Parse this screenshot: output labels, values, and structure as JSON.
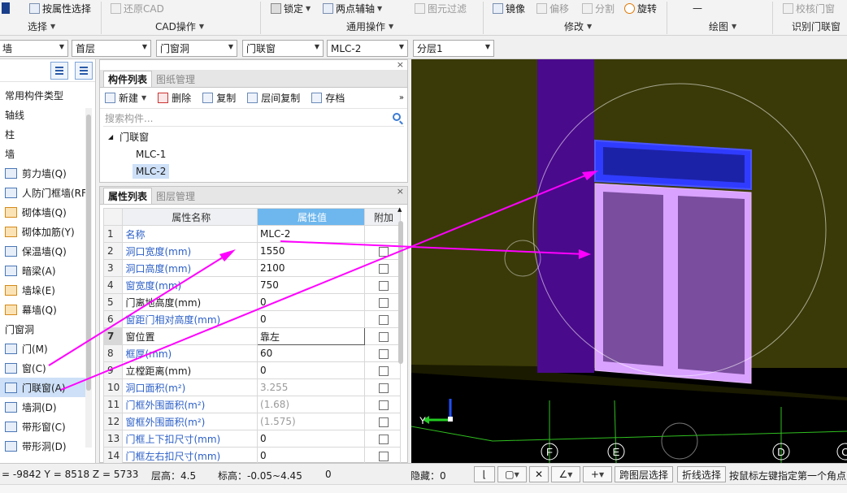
{
  "ribbon": {
    "row1": {
      "attr_select": "按属性选择",
      "restore_cad": "还原CAD",
      "lock": "锁定",
      "two_point_aux": "两点辅轴",
      "element_filter": "图元过滤",
      "mirror": "镜像",
      "offset": "偏移",
      "split": "分割",
      "rotate": "旋转",
      "check_door_window": "校核门窗"
    },
    "groups": {
      "select": "选择",
      "cad_ops": "CAD操作",
      "common_ops": "通用操作",
      "modify": "修改",
      "draw": "绘图",
      "identify_door_window": "识别门联窗"
    }
  },
  "selbar": {
    "combo_type": "墙",
    "combo_floor": "首层",
    "combo_category": "门窗洞",
    "combo_element": "门联窗",
    "combo_name": "MLC-2",
    "combo_layer": "分层1"
  },
  "left_tree": {
    "items": [
      {
        "label": "常用构件类型",
        "icon": "",
        "indent": false
      },
      {
        "label": "轴线",
        "icon": "",
        "indent": false
      },
      {
        "label": "柱",
        "icon": "",
        "indent": false
      },
      {
        "label": "墙",
        "icon": "",
        "indent": false
      },
      {
        "label": "剪力墙(Q)",
        "icon": "shear-wall-icon",
        "indent": true
      },
      {
        "label": "人防门框墙(RF",
        "icon": "civil-defense-wall-icon",
        "indent": true
      },
      {
        "label": "砌体墙(Q)",
        "icon": "masonry-wall-icon",
        "indent": true
      },
      {
        "label": "砌体加筋(Y)",
        "icon": "masonry-rebar-icon",
        "indent": true
      },
      {
        "label": "保温墙(Q)",
        "icon": "insulation-wall-icon",
        "indent": true
      },
      {
        "label": "暗梁(A)",
        "icon": "hidden-beam-icon",
        "indent": true
      },
      {
        "label": "墙垛(E)",
        "icon": "wall-pier-icon",
        "indent": true
      },
      {
        "label": "幕墙(Q)",
        "icon": "curtain-wall-icon",
        "indent": true
      },
      {
        "label": "门窗洞",
        "icon": "",
        "indent": false
      },
      {
        "label": "门(M)",
        "icon": "door-icon",
        "indent": true
      },
      {
        "label": "窗(C)",
        "icon": "window-icon",
        "indent": true
      },
      {
        "label": "门联窗(A)",
        "icon": "door-window-icon",
        "indent": true,
        "selected": true
      },
      {
        "label": "墙洞(D)",
        "icon": "wall-opening-icon",
        "indent": true
      },
      {
        "label": "带形窗(C)",
        "icon": "strip-window-icon",
        "indent": true
      },
      {
        "label": "带形洞(D)",
        "icon": "strip-opening-icon",
        "indent": true
      }
    ]
  },
  "component_panel": {
    "tabs": [
      "构件列表",
      "图纸管理"
    ],
    "toolbar": {
      "new": "新建",
      "delete": "删除",
      "copy": "复制",
      "floor_copy": "层间复制",
      "archive": "存档"
    },
    "search_placeholder": "搜索构件...",
    "tree": {
      "root": "门联窗",
      "children": [
        "MLC-1",
        "MLC-2"
      ],
      "selected": "MLC-2"
    }
  },
  "property_panel": {
    "tabs": [
      "属性列表",
      "图层管理"
    ],
    "headers": {
      "name": "属性名称",
      "value": "属性值",
      "extra": "附加"
    },
    "rows": [
      {
        "num": "1",
        "name": "名称",
        "value": "MLC-2",
        "blue": true,
        "gray": false,
        "check": false
      },
      {
        "num": "2",
        "name": "洞口宽度(mm)",
        "value": "1550",
        "blue": true,
        "gray": false,
        "check": true
      },
      {
        "num": "3",
        "name": "洞口高度(mm)",
        "value": "2100",
        "blue": true,
        "gray": false,
        "check": true
      },
      {
        "num": "4",
        "name": "窗宽度(mm)",
        "value": "750",
        "blue": true,
        "gray": false,
        "check": true
      },
      {
        "num": "5",
        "name": "门离地高度(mm)",
        "value": "0",
        "blue": false,
        "gray": false,
        "check": true
      },
      {
        "num": "6",
        "name": "窗距门相对高度(mm)",
        "value": "0",
        "blue": true,
        "gray": false,
        "check": true
      },
      {
        "num": "7",
        "name": "窗位置",
        "value": "靠左",
        "blue": false,
        "gray": false,
        "check": true,
        "current": true
      },
      {
        "num": "8",
        "name": "框厚(mm)",
        "value": "60",
        "blue": true,
        "gray": false,
        "check": true
      },
      {
        "num": "9",
        "name": "立樘距离(mm)",
        "value": "0",
        "blue": false,
        "gray": false,
        "check": true
      },
      {
        "num": "10",
        "name": "洞口面积(m²)",
        "value": "3.255",
        "blue": true,
        "gray": true,
        "check": true
      },
      {
        "num": "11",
        "name": "门框外围面积(m²)",
        "value": "(1.68)",
        "blue": true,
        "gray": true,
        "check": true
      },
      {
        "num": "12",
        "name": "窗框外围面积(m²)",
        "value": "(1.575)",
        "blue": true,
        "gray": true,
        "check": true
      },
      {
        "num": "13",
        "name": "门框上下扣尺寸(mm)",
        "value": "0",
        "blue": true,
        "gray": false,
        "check": true
      },
      {
        "num": "14",
        "name": "门框左右扣尺寸(mm)",
        "value": "0",
        "blue": true,
        "gray": false,
        "check": true
      }
    ]
  },
  "viewport": {
    "axis_labels": [
      "F",
      "E",
      "D",
      "C"
    ],
    "axis_y": "Y",
    "colors": {
      "wall": "#3a3a08",
      "column": "#4a0a8c",
      "window_frame": "#2f3cff",
      "door_frame": "#d9a2ff",
      "grid": "#2fbf1f",
      "arrow": "#ff00ff"
    }
  },
  "statusbar": {
    "coords": "= -9842 Y = 8518 Z = 5733",
    "floor_height": "层高：4.5",
    "elevation": "标高：-0.05~4.45",
    "zero": "0",
    "hidden": "隐藏：0",
    "cross_layer_select": "跨图层选择",
    "line_select": "折线选择",
    "hint": "按鼠标左键指定第一个角点"
  }
}
